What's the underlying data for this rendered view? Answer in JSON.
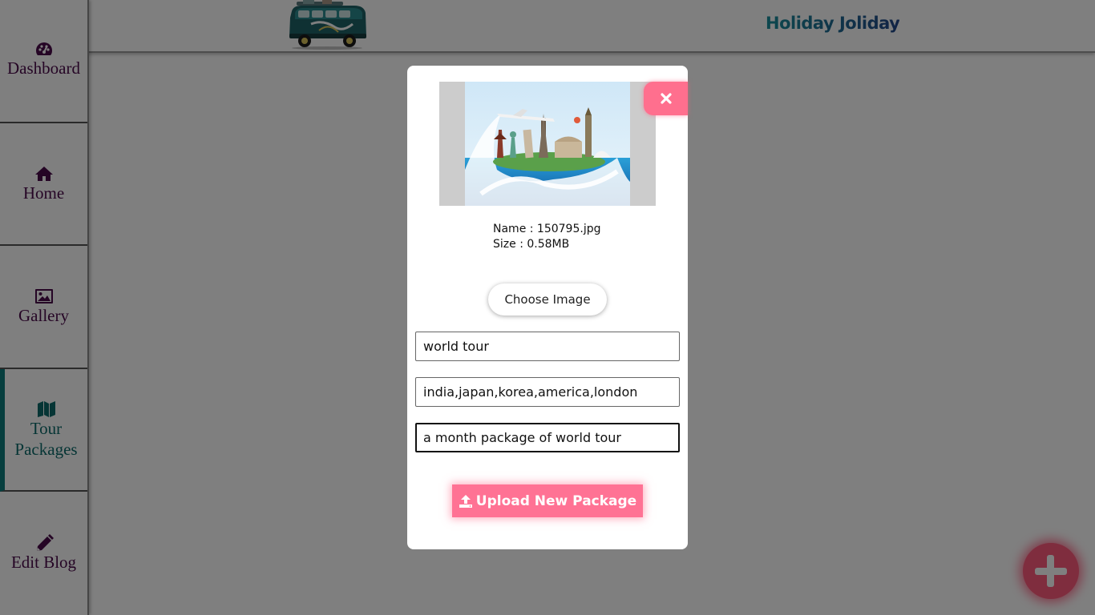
{
  "header": {
    "brand": "Holiday Joliday",
    "logo_icon": "camper-van-logo"
  },
  "sidebar": {
    "items": [
      {
        "label": "Dashboard",
        "icon": "dashboard-icon",
        "active": false
      },
      {
        "label": "Home",
        "icon": "home-icon",
        "active": false
      },
      {
        "label": "Gallery",
        "icon": "image-icon",
        "active": false
      },
      {
        "label": "Tour Packages",
        "icon": "map-icon",
        "active": true
      },
      {
        "label": "Edit Blog",
        "icon": "pencil-icon",
        "active": false
      }
    ]
  },
  "modal": {
    "preview_icon": "world-landmarks-image",
    "close_icon": "close-icon",
    "file_name": "Name : 150795.jpg",
    "file_size": "Size : 0.58MB",
    "choose_label": "Choose Image",
    "fields": [
      {
        "value": "world tour"
      },
      {
        "value": "india,japan,korea,america,london"
      },
      {
        "value": "a month package of world tour"
      }
    ],
    "upload_label": "Upload New Package",
    "upload_icon": "upload-icon"
  },
  "fab": {
    "icon": "plus-icon"
  },
  "colors": {
    "sidebar_text": "#4a0a4a",
    "active_text": "#0c6b6b",
    "accent_pink": "#ff7294",
    "brand_teal": "#1a8f9c",
    "brand_blue": "#23478a"
  }
}
